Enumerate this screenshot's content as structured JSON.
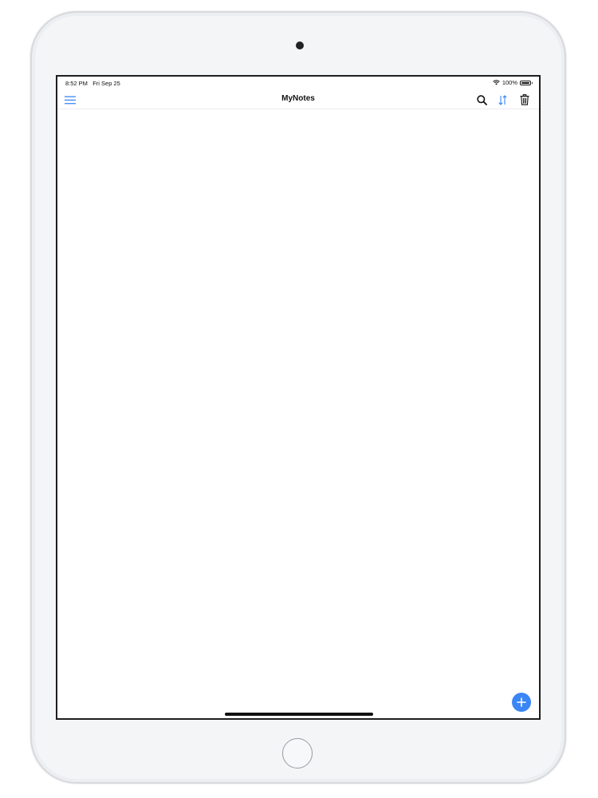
{
  "status_bar": {
    "time": "8:52 PM",
    "date": "Fri Sep 25",
    "battery": "100%",
    "battery_level": 1.0
  },
  "nav_bar": {
    "title": "MyNotes",
    "left_icon": "menu-icon",
    "right_icons": [
      "search-icon",
      "sort-icon",
      "trash-icon"
    ]
  },
  "fab": {
    "icon": "plus-icon"
  },
  "colors": {
    "accent": "#3a86f5",
    "text": "#111111",
    "background": "#ffffff"
  }
}
